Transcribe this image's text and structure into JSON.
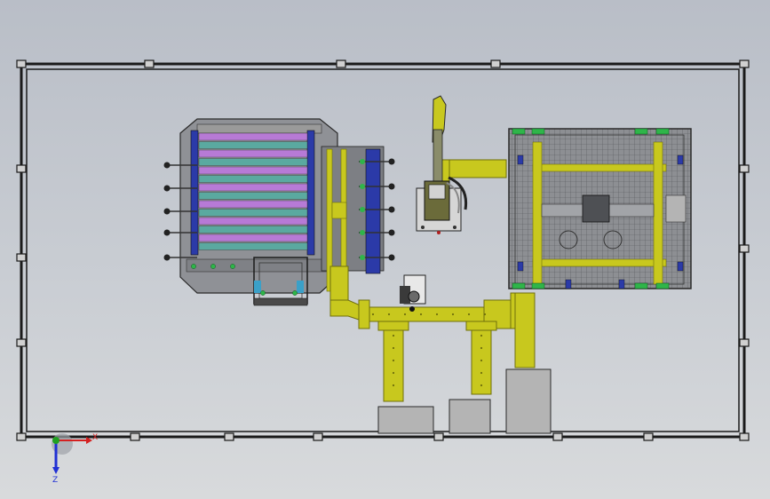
{
  "axes": {
    "x_label": "X",
    "z_label": "Z"
  },
  "colors": {
    "frame": "#1a1a1a",
    "plate": "#9a9a9a",
    "plate_dark": "#5e6064",
    "rail_yellow": "#c8c81e",
    "rail_yellow_dark": "#6f6f0c",
    "magenta": "#b77ad6",
    "teal": "#5aa9a0",
    "blue": "#2b3aa8",
    "green": "#2fb54a",
    "box": "#b4b4b4",
    "axis_x": "#d42020",
    "axis_y": "#20a020",
    "axis_z": "#2030d4"
  }
}
